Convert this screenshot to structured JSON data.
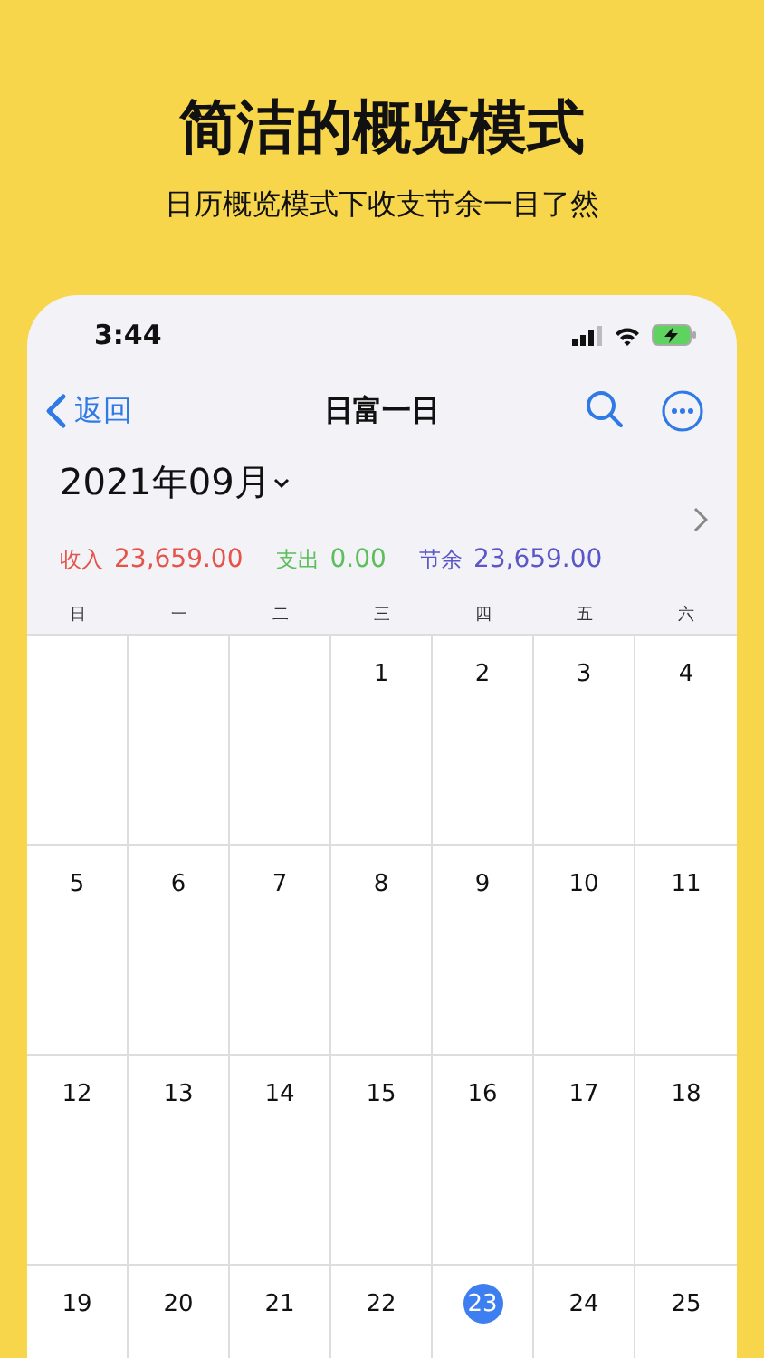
{
  "headline": "简洁的概览模式",
  "subtitle": "日历概览模式下收支节余一目了然",
  "status_bar": {
    "time": "3:44"
  },
  "nav": {
    "back": "返回",
    "title": "日富一日"
  },
  "month": {
    "label": "2021年09月"
  },
  "summary": [
    {
      "label": "收入",
      "value": "23,659.00",
      "color": "#e5534b"
    },
    {
      "label": "支出",
      "value": "0.00",
      "color": "#5cbf5c"
    },
    {
      "label": "节余",
      "value": "23,659.00",
      "color": "#5b57c9"
    }
  ],
  "weekdays": [
    "日",
    "一",
    "二",
    "三",
    "四",
    "五",
    "六"
  ],
  "weeks": [
    [
      {
        "kind": "blank"
      },
      {
        "kind": "blank"
      },
      {
        "kind": "blank"
      },
      {
        "kind": "day",
        "day": "1",
        "selected": false
      },
      {
        "kind": "day",
        "day": "2",
        "selected": false
      },
      {
        "kind": "day",
        "day": "3",
        "selected": false
      },
      {
        "kind": "day",
        "day": "4",
        "selected": false
      }
    ],
    [
      {
        "kind": "day",
        "day": "5",
        "selected": false
      },
      {
        "kind": "day",
        "day": "6",
        "selected": false
      },
      {
        "kind": "day",
        "day": "7",
        "selected": false
      },
      {
        "kind": "day",
        "day": "8",
        "selected": false
      },
      {
        "kind": "day",
        "day": "9",
        "selected": false
      },
      {
        "kind": "day",
        "day": "10",
        "selected": false
      },
      {
        "kind": "day",
        "day": "11",
        "selected": false
      }
    ],
    [
      {
        "kind": "day",
        "day": "12",
        "selected": false
      },
      {
        "kind": "day",
        "day": "13",
        "selected": false
      },
      {
        "kind": "day",
        "day": "14",
        "selected": false
      },
      {
        "kind": "day",
        "day": "15",
        "selected": false
      },
      {
        "kind": "day",
        "day": "16",
        "selected": false
      },
      {
        "kind": "day",
        "day": "17",
        "selected": false
      },
      {
        "kind": "day",
        "day": "18",
        "selected": false
      }
    ],
    [
      {
        "kind": "day",
        "day": "19",
        "selected": false
      },
      {
        "kind": "day",
        "day": "20",
        "selected": false
      },
      {
        "kind": "day",
        "day": "21",
        "selected": false
      },
      {
        "kind": "day",
        "day": "22",
        "selected": false
      },
      {
        "kind": "day",
        "day": "23",
        "selected": true
      },
      {
        "kind": "day",
        "day": "24",
        "selected": false
      },
      {
        "kind": "day",
        "day": "25",
        "selected": false
      }
    ]
  ]
}
